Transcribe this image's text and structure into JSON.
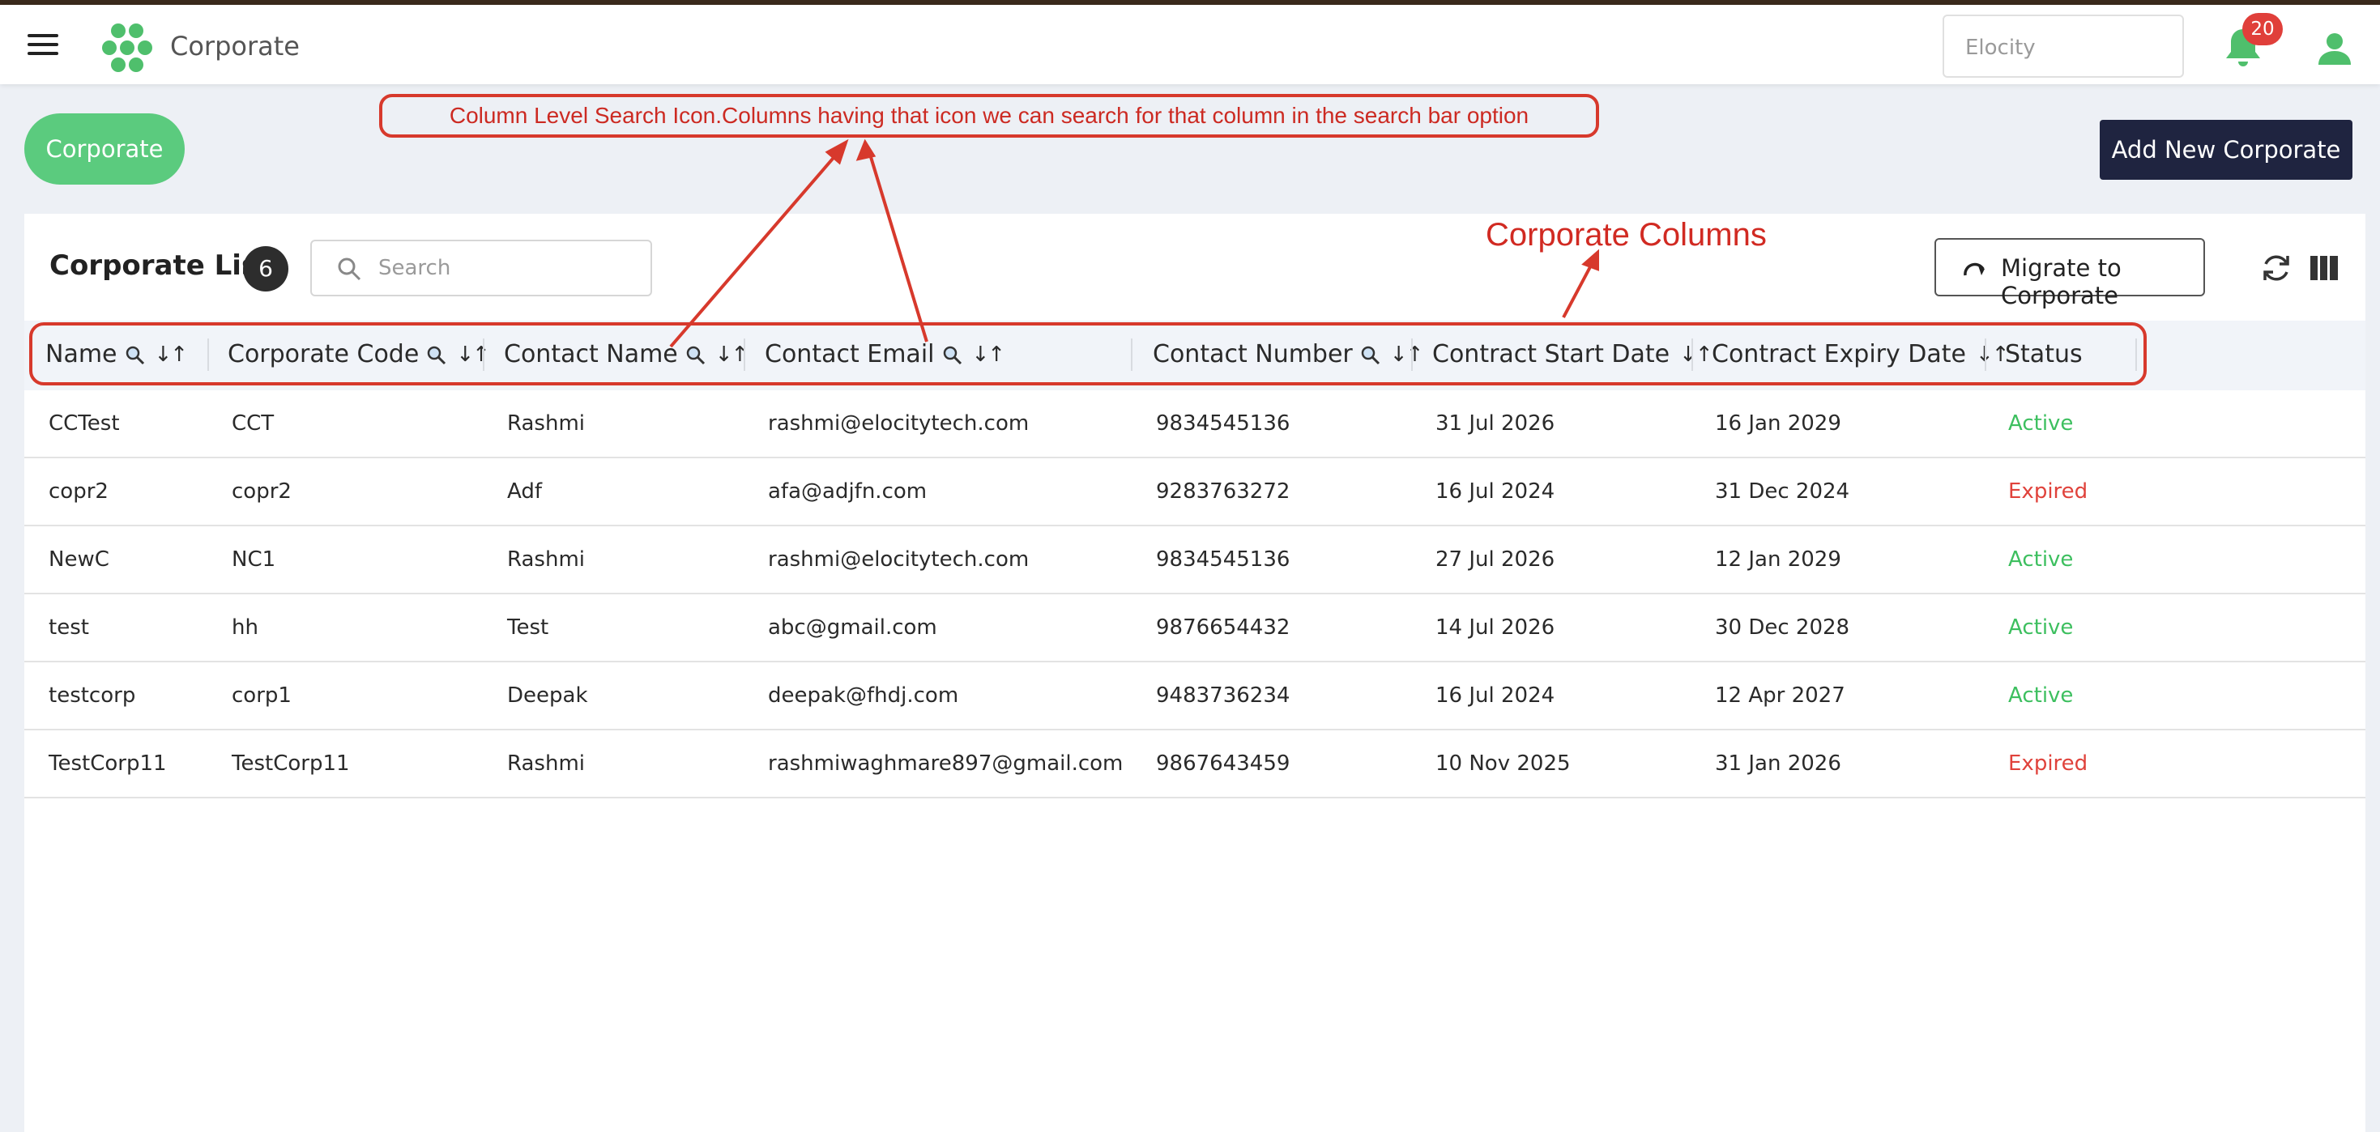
{
  "header": {
    "app_title": "Corporate",
    "org_selector_value": "Elocity",
    "notification_count": "20"
  },
  "page": {
    "pill_label": "Corporate",
    "add_button_label": "Add New Corporate"
  },
  "annotations": {
    "top_note": "Column Level Search Icon.Columns having that icon we can search for that column in the search bar option",
    "columns_note": "Corporate Columns"
  },
  "list": {
    "title": "Corporate List",
    "count": "6",
    "search_placeholder": "Search",
    "migrate_label": "Migrate to Corporate"
  },
  "table": {
    "columns": [
      {
        "label": "Name",
        "searchable": true,
        "sortable": true
      },
      {
        "label": "Corporate Code",
        "searchable": true,
        "sortable": true
      },
      {
        "label": "Contact Name",
        "searchable": true,
        "sortable": true
      },
      {
        "label": "Contact Email",
        "searchable": true,
        "sortable": true
      },
      {
        "label": "Contact Number",
        "searchable": true,
        "sortable": true
      },
      {
        "label": "Contract Start Date",
        "searchable": false,
        "sortable": true
      },
      {
        "label": "Contract Expiry Date",
        "searchable": false,
        "sortable": true
      },
      {
        "label": "Status",
        "searchable": false,
        "sortable": false
      }
    ],
    "sort_glyph": "↓↑",
    "rows": [
      [
        "CCTest",
        "CCT",
        "Rashmi",
        "rashmi@elocitytech.com",
        "9834545136",
        "31 Jul 2026",
        "16 Jan 2029",
        "Active"
      ],
      [
        "copr2",
        "copr2",
        "Adf",
        "afa@adjfn.com",
        "9283763272",
        "16 Jul 2024",
        "31 Dec 2024",
        "Expired"
      ],
      [
        "NewC",
        "NC1",
        "Rashmi",
        "rashmi@elocitytech.com",
        "9834545136",
        "27 Jul 2026",
        "12 Jan 2029",
        "Active"
      ],
      [
        "test",
        "hh",
        "Test",
        "abc@gmail.com",
        "9876654432",
        "14 Jul 2026",
        "30 Dec 2028",
        "Active"
      ],
      [
        "testcorp",
        "corp1",
        "Deepak",
        "deepak@fhdj.com",
        "9483736234",
        "16 Jul 2024",
        "12 Apr 2027",
        "Active"
      ],
      [
        "TestCorp11",
        "TestCorp11",
        "Rashmi",
        "rashmiwaghmare897@gmail.com",
        "9867643459",
        "10 Nov 2025",
        "31 Jan 2026",
        "Expired"
      ]
    ]
  },
  "colors": {
    "accent_green": "#5bcb7e",
    "dark_button": "#1f2440",
    "active": "#3dbf5f",
    "expired": "#e0423b",
    "annotation_red": "#d7392c"
  }
}
